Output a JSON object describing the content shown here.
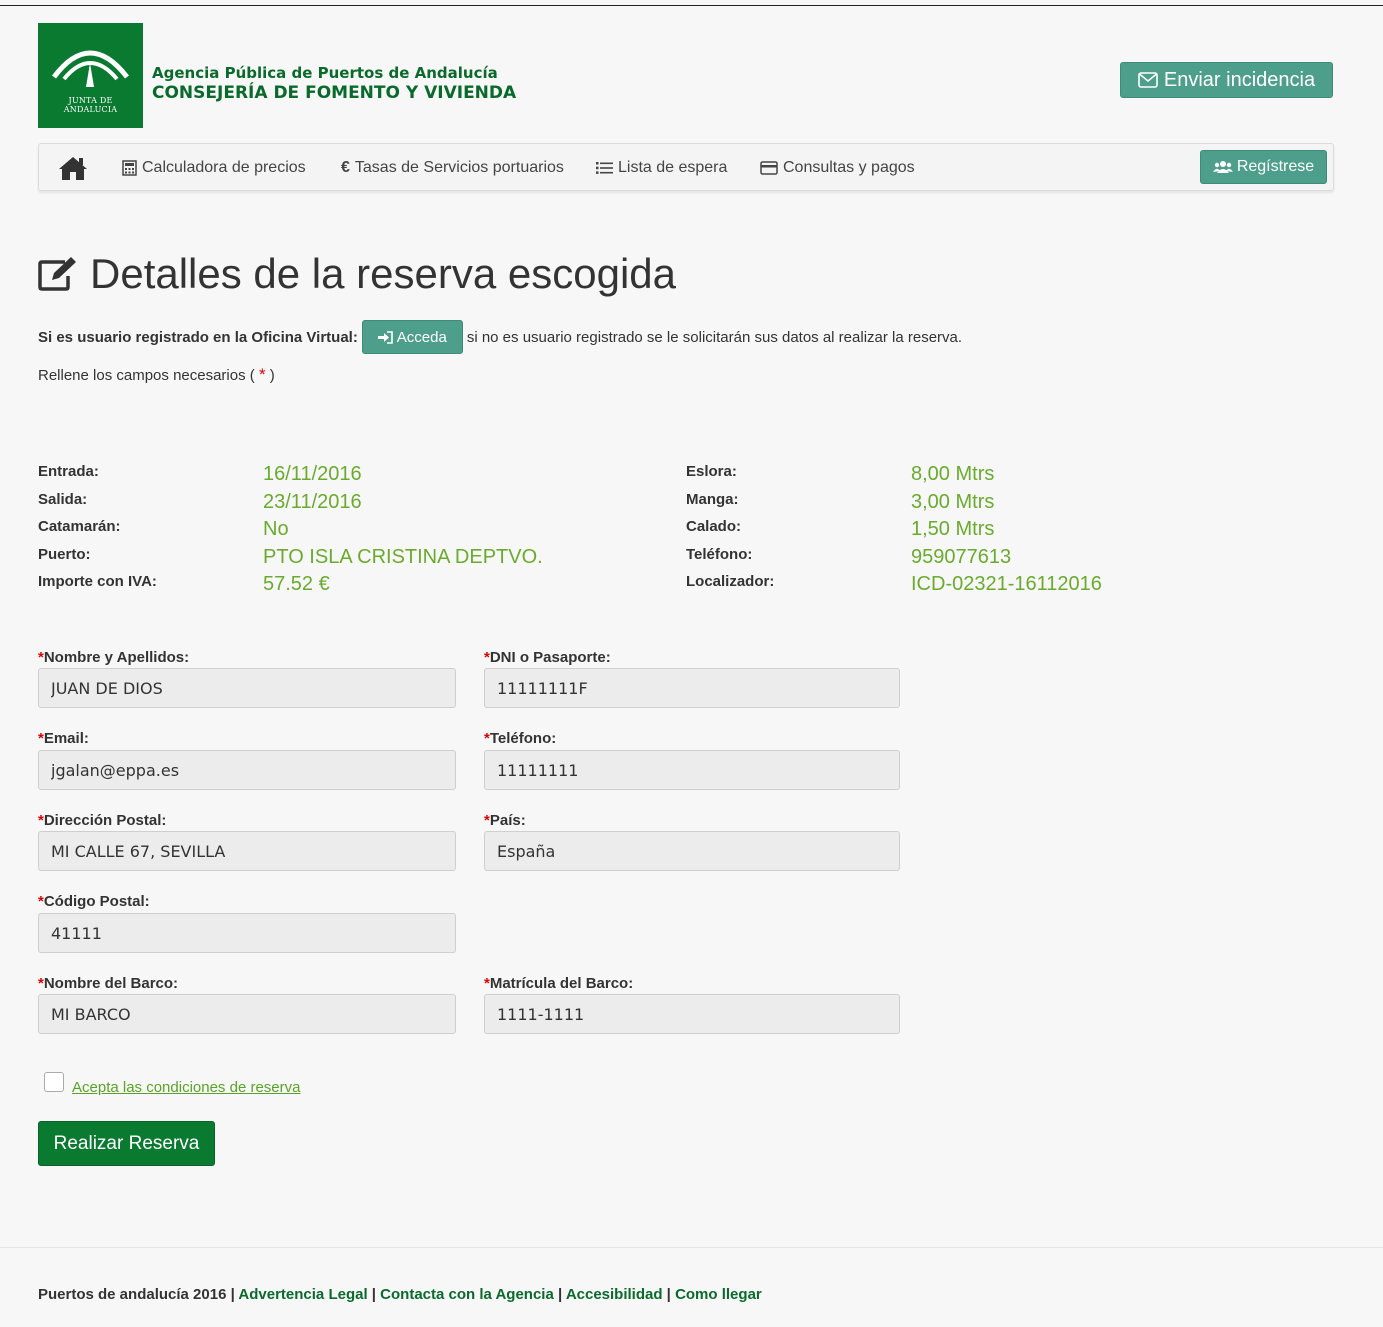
{
  "header": {
    "logo_text": "JUNTA DE ANDALUCIA",
    "agency_line1": "Agencia Pública de Puertos de Andalucía",
    "agency_line2": "CONSEJERÍA DE FOMENTO Y VIVIENDA",
    "incidencia_label": "Enviar incidencia"
  },
  "nav": {
    "items": [
      {
        "label": "Calculadora de precios",
        "icon": "calculator-icon"
      },
      {
        "label": "Tasas de Servicios portuarios",
        "icon": "euro-icon"
      },
      {
        "label": "Lista de espera",
        "icon": "list-icon"
      },
      {
        "label": "Consultas y pagos",
        "icon": "credit-card-icon"
      }
    ],
    "register_label": "Regístrese"
  },
  "page": {
    "title": "Detalles de la reserva escogida",
    "registered_prefix": "Si es usuario registrado en la Oficina Virtual:",
    "acceda_label": "Acceda",
    "registered_suffix": "si no es usuario registrado se le solicitarán sus datos al realizar la reserva.",
    "hint_prefix": "Rellene los campos necesarios (",
    "hint_star": "*",
    "hint_suffix": ")"
  },
  "details": {
    "left": [
      {
        "label": "Entrada:",
        "value": "16/11/2016"
      },
      {
        "label": "Salida:",
        "value": "23/11/2016"
      },
      {
        "label": "Catamarán:",
        "value": "No"
      },
      {
        "label": "Puerto:",
        "value": "PTO ISLA CRISTINA DEPTVO."
      },
      {
        "label": "Importe con IVA:",
        "value": "57.52 €"
      }
    ],
    "right": [
      {
        "label": "Eslora:",
        "value": "8,00 Mtrs"
      },
      {
        "label": "Manga:",
        "value": "3,00 Mtrs"
      },
      {
        "label": "Calado:",
        "value": "1,50 Mtrs"
      },
      {
        "label": "Teléfono:",
        "value": "959077613"
      },
      {
        "label": "Localizador:",
        "value": "ICD-02321-16112016"
      }
    ]
  },
  "form": {
    "nombre": {
      "label": "Nombre y Apellidos:",
      "value": "JUAN DE DIOS"
    },
    "dni": {
      "label": "DNI o Pasaporte:",
      "value": "11111111F"
    },
    "email": {
      "label": "Email:",
      "value": "jgalan@eppa.es"
    },
    "telefono": {
      "label": "Teléfono:",
      "value": "11111111"
    },
    "direccion": {
      "label": "Dirección Postal:",
      "value": "MI CALLE 67, SEVILLA"
    },
    "pais": {
      "label": "País:",
      "value": "España"
    },
    "codigo": {
      "label": "Código Postal:",
      "value": "41111"
    },
    "barco": {
      "label": "Nombre del Barco:",
      "value": "MI BARCO"
    },
    "matricula": {
      "label": "Matrícula del Barco:",
      "value": "1111-1111"
    },
    "required_star": "*",
    "accept_label": "Acepta las condiciones de reserva",
    "accept_checked": false,
    "submit_label": "Realizar Reserva"
  },
  "footer": {
    "copyright": "Puertos de andalucía 2016",
    "separator": " | ",
    "links": [
      "Advertencia Legal",
      "Contacta con la Agencia",
      "Accesibilidad",
      "Como llegar"
    ]
  },
  "colors": {
    "brand_green": "#0a7a31",
    "teal_button": "#4e9e8c",
    "value_green": "#6aab2e",
    "required_red": "#dd0000"
  }
}
